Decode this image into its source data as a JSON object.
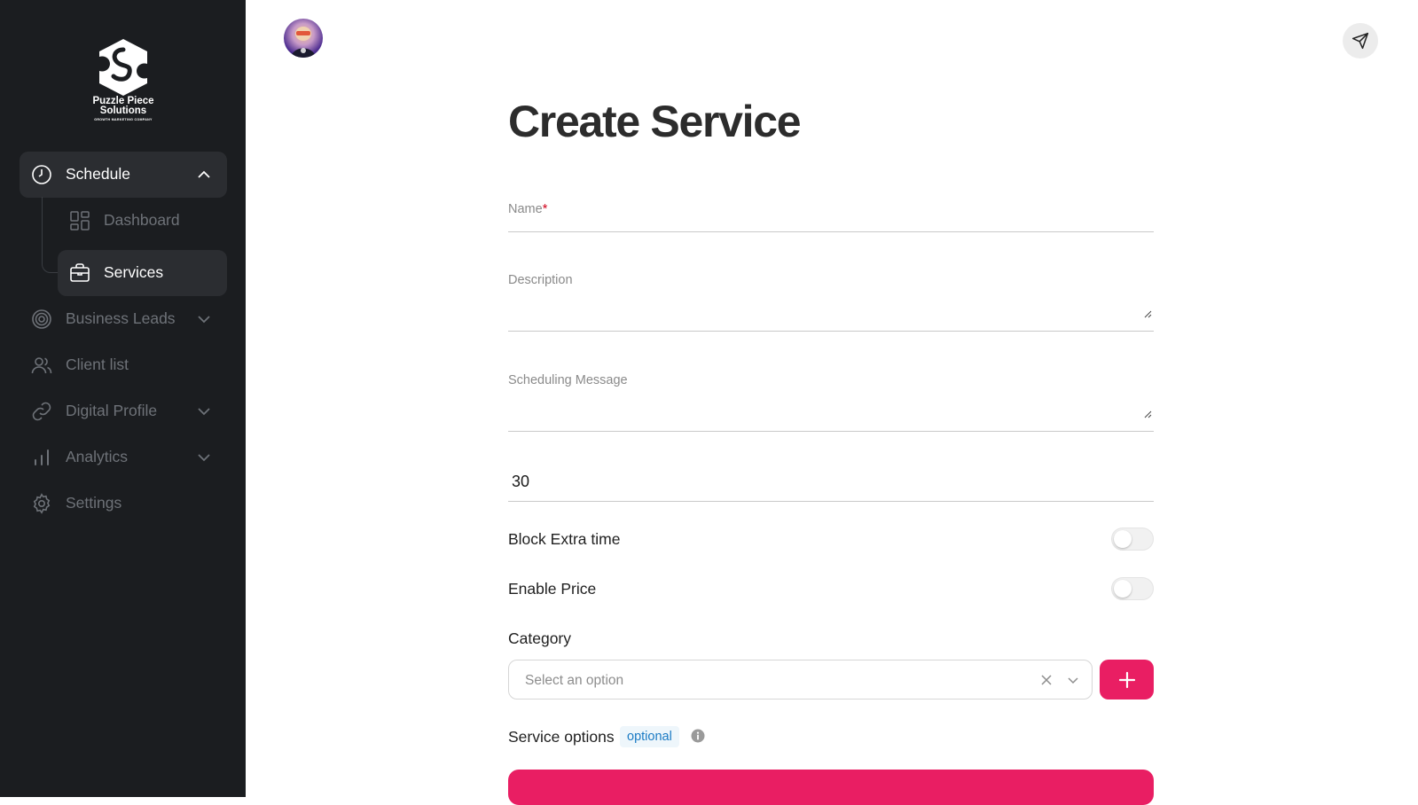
{
  "brand": {
    "line1": "Puzzle Piece",
    "line2": "Solutions",
    "tagline": "GROWTH MARKETING COMPANY"
  },
  "sidebar": {
    "schedule": {
      "label": "Schedule",
      "icon": "clock-icon",
      "expanded": true
    },
    "dashboard": {
      "label": "Dashboard",
      "icon": "grid-icon"
    },
    "services": {
      "label": "Services",
      "icon": "briefcase-icon"
    },
    "business_leads": {
      "label": "Business Leads",
      "icon": "target-icon"
    },
    "client_list": {
      "label": "Client list",
      "icon": "users-icon"
    },
    "digital_profile": {
      "label": "Digital Profile",
      "icon": "link-icon"
    },
    "analytics": {
      "label": "Analytics",
      "icon": "bar-chart-icon"
    },
    "settings": {
      "label": "Settings",
      "icon": "gear-icon"
    }
  },
  "header": {
    "avatar_icon": "avatar",
    "send_icon": "send-icon"
  },
  "form": {
    "title": "Create Service",
    "name_label": "Name",
    "name_required": "*",
    "description_label": "Description",
    "scheduling_message_label": "Scheduling Message",
    "duration_value": "30",
    "block_extra_time_label": "Block Extra time",
    "block_extra_time_enabled": false,
    "enable_price_label": "Enable Price",
    "enable_price_enabled": false,
    "category_label": "Category",
    "category_placeholder": "Select an option",
    "service_options_label": "Service options",
    "optional_badge": "optional"
  },
  "colors": {
    "accent": "#e91e63",
    "sidebar_bg": "#1b1d20",
    "sidebar_active": "#2b2d31",
    "badge_text": "#1b7bc4"
  }
}
